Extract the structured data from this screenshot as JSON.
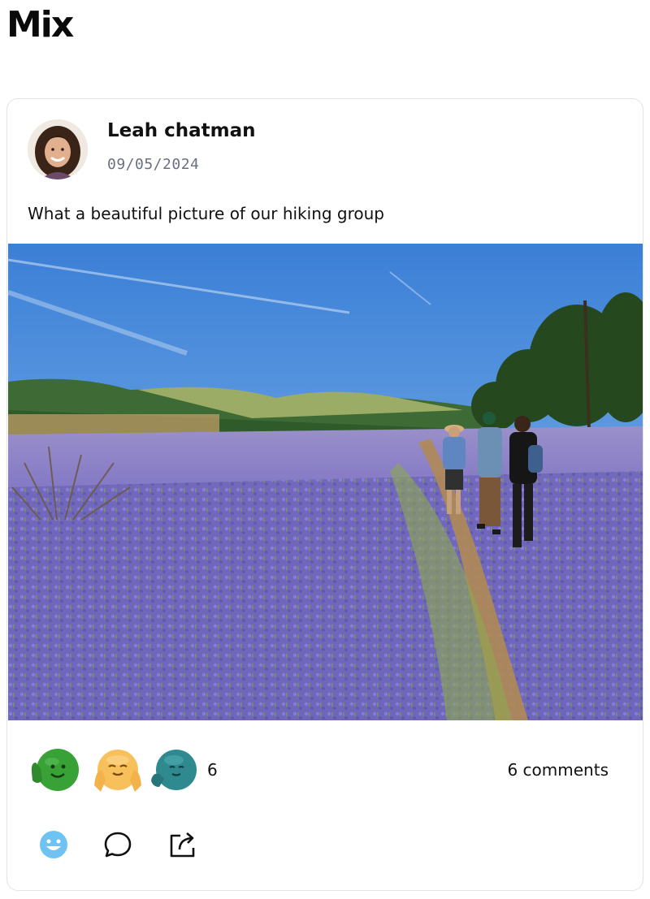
{
  "app": {
    "title": "Mix"
  },
  "post": {
    "author": "Leah chatman",
    "date": "09/05/2024",
    "text": "What a beautiful picture of our hiking group",
    "photo_icon": "landscape-photo"
  },
  "reactions": {
    "emojis": [
      "waving-smile-emoji",
      "hands-on-cheeks-emoji",
      "calm-thinking-emoji"
    ],
    "count": "6"
  },
  "comments": {
    "label": "6 comments"
  },
  "actions": {
    "react_icon": "smiley-icon",
    "comment_icon": "speech-bubble-icon",
    "share_icon": "share-icon"
  },
  "colors": {
    "react_accent": "#6ec3f2",
    "sky": "#3d86dc",
    "lupine": "#7e6fd0"
  }
}
